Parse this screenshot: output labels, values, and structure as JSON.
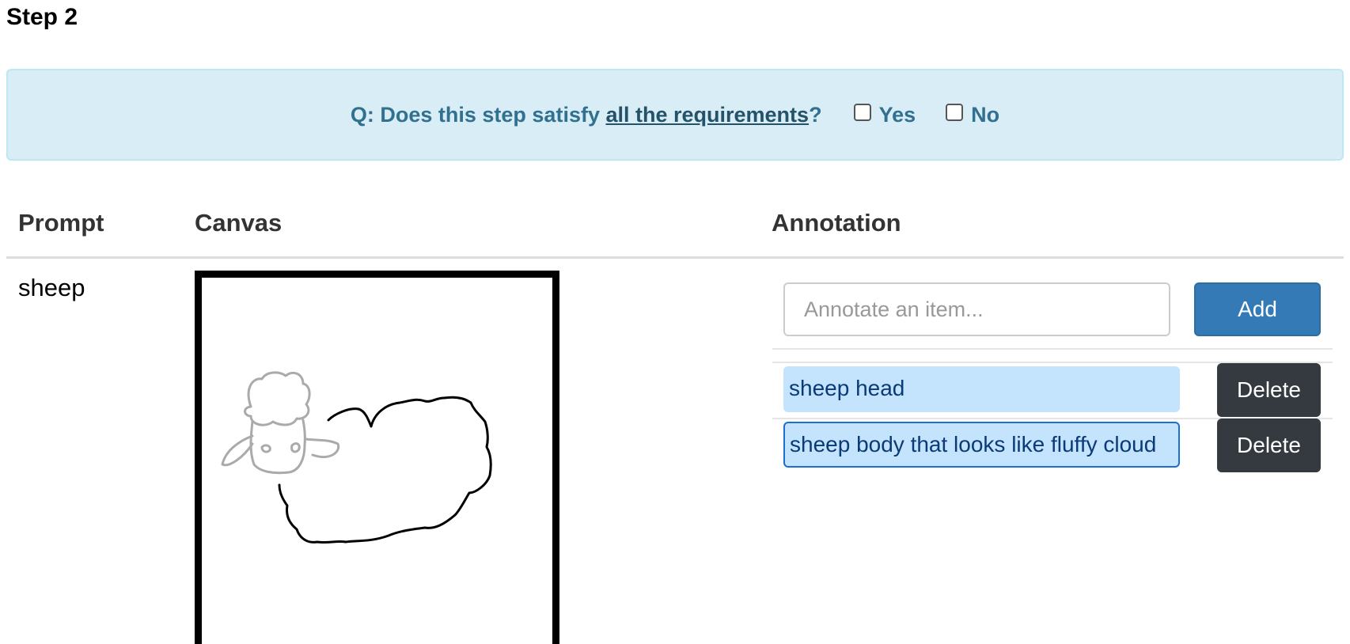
{
  "step": {
    "title": "Step 2"
  },
  "question": {
    "prefix": "Q: Does this step satisfy ",
    "link_text": "all the requirements",
    "suffix": "?",
    "options": [
      {
        "label": "Yes",
        "checked": false
      },
      {
        "label": "No",
        "checked": false
      }
    ]
  },
  "table": {
    "headers": {
      "prompt": "Prompt",
      "canvas": "Canvas",
      "annotation": "Annotation"
    },
    "row": {
      "prompt": "sheep"
    }
  },
  "annotation": {
    "input_placeholder": "Annotate an item...",
    "input_value": "",
    "add_label": "Add",
    "items": [
      {
        "label": "sheep head",
        "selected": false
      },
      {
        "label": "sheep body that looks like fluffy cloud",
        "selected": true
      }
    ],
    "delete_label": "Delete"
  },
  "colors": {
    "alert_bg": "#d9edf7",
    "alert_text": "#31708f",
    "primary_button": "#337ab7",
    "dark_button": "#343a40",
    "item_bg": "#c4e3fc",
    "head_stroke": "#aaaaaa",
    "body_stroke": "#000000"
  }
}
